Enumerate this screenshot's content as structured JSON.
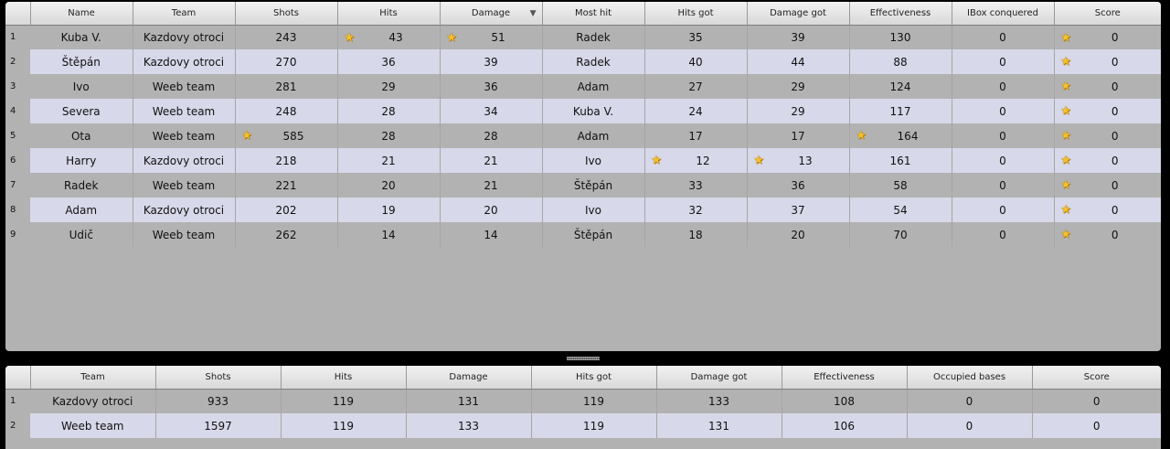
{
  "players_table": {
    "columns": [
      "Name",
      "Team",
      "Shots",
      "Hits",
      "Damage",
      "Most hit",
      "Hits got",
      "Damage got",
      "Effectiveness",
      "IBox conquered",
      "Score"
    ],
    "sort_indicator": "▼",
    "rows": [
      {
        "idx": "1",
        "name": "Kuba V.",
        "team": "Kazdovy otroci",
        "shots": "243",
        "hits": "43",
        "damage": "51",
        "most_hit": "Radek",
        "hits_got": "35",
        "damage_got": "39",
        "effectiveness": "130",
        "ibox": "0",
        "score": "0"
      },
      {
        "idx": "2",
        "name": "Štěpán",
        "team": "Kazdovy otroci",
        "shots": "270",
        "hits": "36",
        "damage": "39",
        "most_hit": "Radek",
        "hits_got": "40",
        "damage_got": "44",
        "effectiveness": "88",
        "ibox": "0",
        "score": "0"
      },
      {
        "idx": "3",
        "name": "Ivo",
        "team": "Weeb team",
        "shots": "281",
        "hits": "29",
        "damage": "36",
        "most_hit": "Adam",
        "hits_got": "27",
        "damage_got": "29",
        "effectiveness": "124",
        "ibox": "0",
        "score": "0"
      },
      {
        "idx": "4",
        "name": "Severa",
        "team": "Weeb team",
        "shots": "248",
        "hits": "28",
        "damage": "34",
        "most_hit": "Kuba V.",
        "hits_got": "24",
        "damage_got": "29",
        "effectiveness": "117",
        "ibox": "0",
        "score": "0"
      },
      {
        "idx": "5",
        "name": "Ota",
        "team": "Weeb team",
        "shots": "585",
        "hits": "28",
        "damage": "28",
        "most_hit": "Adam",
        "hits_got": "17",
        "damage_got": "17",
        "effectiveness": "164",
        "ibox": "0",
        "score": "0"
      },
      {
        "idx": "6",
        "name": "Harry",
        "team": "Kazdovy otroci",
        "shots": "218",
        "hits": "21",
        "damage": "21",
        "most_hit": "Ivo",
        "hits_got": "12",
        "damage_got": "13",
        "effectiveness": "161",
        "ibox": "0",
        "score": "0"
      },
      {
        "idx": "7",
        "name": "Radek",
        "team": "Weeb team",
        "shots": "221",
        "hits": "20",
        "damage": "21",
        "most_hit": "Štěpán",
        "hits_got": "33",
        "damage_got": "36",
        "effectiveness": "58",
        "ibox": "0",
        "score": "0"
      },
      {
        "idx": "8",
        "name": "Adam",
        "team": "Kazdovy otroci",
        "shots": "202",
        "hits": "19",
        "damage": "20",
        "most_hit": "Ivo",
        "hits_got": "32",
        "damage_got": "37",
        "effectiveness": "54",
        "ibox": "0",
        "score": "0"
      },
      {
        "idx": "9",
        "name": "Udič",
        "team": "Weeb team",
        "shots": "262",
        "hits": "14",
        "damage": "14",
        "most_hit": "Štěpán",
        "hits_got": "18",
        "damage_got": "20",
        "effectiveness": "70",
        "ibox": "0",
        "score": "0"
      }
    ]
  },
  "teams_table": {
    "columns": [
      "Team",
      "Shots",
      "Hits",
      "Damage",
      "Hits got",
      "Damage got",
      "Effectiveness",
      "Occupied bases",
      "Score"
    ],
    "rows": [
      {
        "idx": "1",
        "team": "Kazdovy otroci",
        "shots": "933",
        "hits": "119",
        "damage": "131",
        "hits_got": "119",
        "damage_got": "133",
        "effectiveness": "108",
        "occupied_bases": "0",
        "score": "0"
      },
      {
        "idx": "2",
        "team": "Weeb team",
        "shots": "1597",
        "hits": "119",
        "damage": "133",
        "hits_got": "119",
        "damage_got": "131",
        "effectiveness": "106",
        "occupied_bases": "0",
        "score": "0"
      }
    ]
  },
  "star_icon": "★",
  "colors": {
    "panel_bg": "#b2b2b2",
    "alt_row_bg": "#d7d8e9",
    "star": "#f2c12e"
  }
}
